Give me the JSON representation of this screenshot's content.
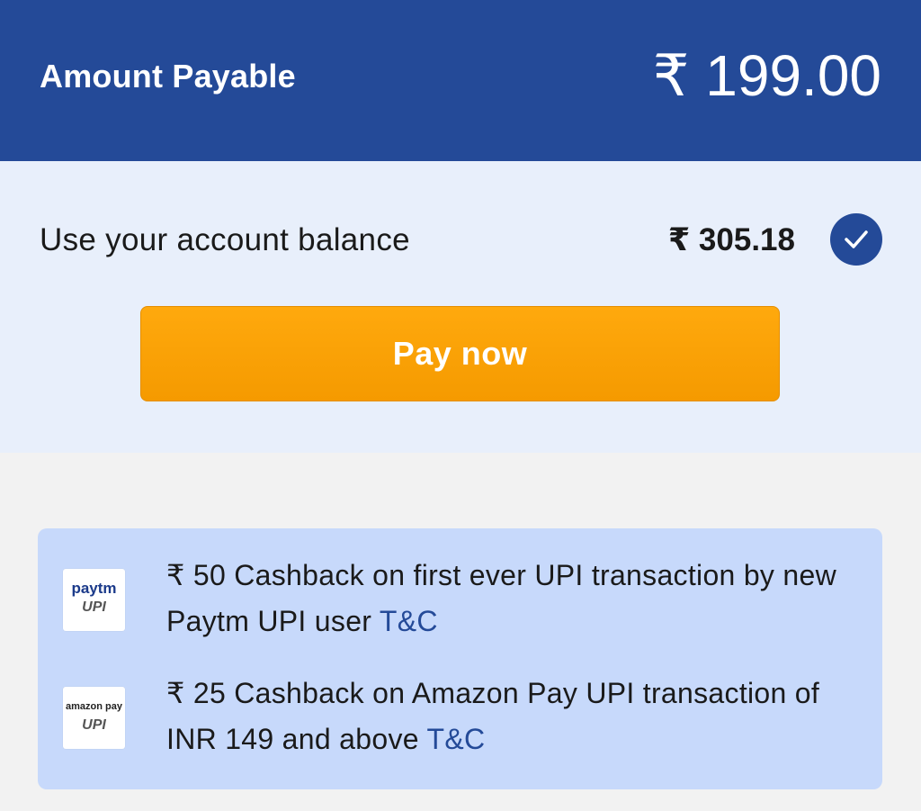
{
  "header": {
    "label": "Amount Payable",
    "amount": "₹ 199.00"
  },
  "balance": {
    "label": "Use your account balance",
    "amount": "₹ 305.18",
    "checked": true
  },
  "pay_button": {
    "label": "Pay now"
  },
  "offers": [
    {
      "logo_brand": "paytm",
      "logo_upi": "UPI",
      "text": "₹ 50 Cashback on first ever UPI transaction by new Paytm UPI user ",
      "tc": "T&C"
    },
    {
      "logo_brand": "amazon pay",
      "logo_upi": "UPI",
      "text": "₹ 25 Cashback on Amazon Pay UPI transaction of INR 149 and above ",
      "tc": "T&C"
    }
  ],
  "colors": {
    "header_bg": "#244a98",
    "balance_bg": "#e8effb",
    "pay_button": "#f9a007",
    "offers_bg": "#c7d9fb",
    "link": "#244a98"
  },
  "icons": {
    "check": "checkmark-icon"
  }
}
